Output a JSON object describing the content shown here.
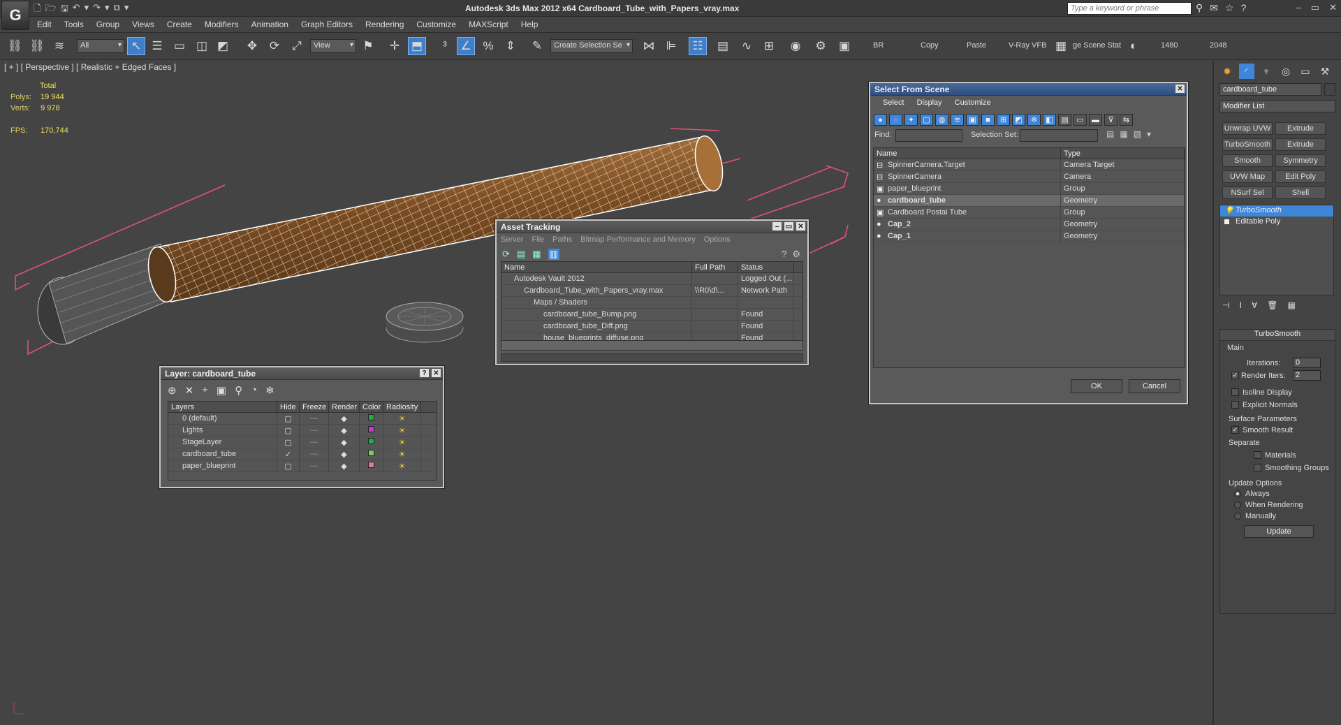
{
  "app": {
    "title": "Autodesk 3ds Max  2012 x64     Cardboard_Tube_with_Papers_vray.max",
    "logo_icon": "3dsmax-logo-icon",
    "search_placeholder": "Type a keyword or phrase"
  },
  "menu": [
    "Edit",
    "Tools",
    "Group",
    "Views",
    "Create",
    "Modifiers",
    "Animation",
    "Graph Editors",
    "Rendering",
    "Customize",
    "MAXScript",
    "Help"
  ],
  "toolbar": {
    "filter_value": "All",
    "view_value": "View",
    "selection_set_value": "Create Selection Se",
    "br_label": "BR",
    "copy_label": "Copy",
    "paste_label": "Paste",
    "vray_label": "V-Ray VFB",
    "scene_state_label": "ge Scene Stat",
    "res1_label": "1480",
    "res2_label": "2048"
  },
  "viewport": {
    "label": "[ + ] [ Perspective ] [ Realistic + Edged Faces ]",
    "stats": {
      "total_label": "Total",
      "polys_label": "Polys:",
      "polys_value": "19 944",
      "verts_label": "Verts:",
      "verts_value": "9 978",
      "fps_label": "FPS:",
      "fps_value": "170,744"
    }
  },
  "layer_window": {
    "title": "Layer: cardboard_tube",
    "columns": [
      "Layers",
      "Hide",
      "Freeze",
      "Render",
      "Color",
      "Radiosity"
    ],
    "rows": [
      {
        "name": "0 (default)",
        "color": "#22aa44",
        "current": false
      },
      {
        "name": "Lights",
        "color": "#c838c8",
        "current": false
      },
      {
        "name": "StageLayer",
        "color": "#22aa44",
        "current": false
      },
      {
        "name": "cardboard_tube",
        "color": "#70d070",
        "current": true
      },
      {
        "name": "paper_blueprint",
        "color": "#e07898",
        "current": false
      }
    ]
  },
  "asset_window": {
    "title": "Asset Tracking",
    "menu": [
      "Server",
      "File",
      "Paths",
      "Bitmap Performance and Memory",
      "Options"
    ],
    "columns": [
      "Name",
      "Full Path",
      "Status"
    ],
    "rows": [
      {
        "name": "Autodesk Vault 2012",
        "path": "",
        "status": "Logged Out (...",
        "indent": 1
      },
      {
        "name": "Cardboard_Tube_with_Papers_vray.max",
        "path": "\\\\R0\\d\\...",
        "status": "Network Path",
        "indent": 2
      },
      {
        "name": "Maps / Shaders",
        "path": "",
        "status": "",
        "indent": 3
      },
      {
        "name": "cardboard_tube_Bump.png",
        "path": "",
        "status": "Found",
        "indent": 4
      },
      {
        "name": "cardboard_tube_Diff.png",
        "path": "",
        "status": "Found",
        "indent": 4
      },
      {
        "name": "house_blueprints_diffuse.png",
        "path": "",
        "status": "Found",
        "indent": 4
      }
    ]
  },
  "select_window": {
    "title": "Select From Scene",
    "menu": [
      "Select",
      "Display",
      "Customize"
    ],
    "find_label": "Find:",
    "selection_set_label": "Selection Set:",
    "columns": [
      "Name",
      "Type"
    ],
    "rows": [
      {
        "name": "SpinnerCamera.Target",
        "type": "Camera Target",
        "bold": false,
        "selected": false
      },
      {
        "name": "SpinnerCamera",
        "type": "Camera",
        "bold": false,
        "selected": false
      },
      {
        "name": "paper_blueprint",
        "type": "Group",
        "bold": false,
        "selected": false
      },
      {
        "name": "cardboard_tube",
        "type": "Geometry",
        "bold": true,
        "selected": true
      },
      {
        "name": "Cardboard Postal Tube",
        "type": "Group",
        "bold": false,
        "selected": false
      },
      {
        "name": "Cap_2",
        "type": "Geometry",
        "bold": true,
        "selected": false
      },
      {
        "name": "Cap_1",
        "type": "Geometry",
        "bold": true,
        "selected": false
      }
    ],
    "ok_label": "OK",
    "cancel_label": "Cancel"
  },
  "command_panel": {
    "object_name": "cardboard_tube",
    "modifier_list_label": "Modifier List",
    "modifier_buttons": [
      "Unwrap UVW",
      "Extrude",
      "TurboSmooth",
      "Extrude",
      "Smooth",
      "Symmetry",
      "UVW Map",
      "Edit Poly",
      "NSurf Sel",
      "Shell"
    ],
    "stack": [
      "TurboSmooth",
      "Editable Poly"
    ],
    "turbosmooth": {
      "title": "TurboSmooth",
      "main_label": "Main",
      "iterations_label": "Iterations:",
      "iterations_value": "0",
      "render_iters_label": "Render Iters:",
      "render_iters_value": "2",
      "isoline_label": "Isoline Display",
      "explicit_normals_label": "Explicit Normals",
      "surface_params_label": "Surface Parameters",
      "smooth_result_label": "Smooth Result",
      "separate_label": "Separate",
      "materials_label": "Materials",
      "smoothing_groups_label": "Smoothing Groups",
      "update_options_label": "Update Options",
      "always_label": "Always",
      "when_rendering_label": "When Rendering",
      "manually_label": "Manually",
      "update_button": "Update"
    }
  },
  "colors": {
    "accent": "#3f86d8",
    "cardboard": "#8a5a2a",
    "stats": "#f0e060",
    "bbox": "#e0507a"
  }
}
